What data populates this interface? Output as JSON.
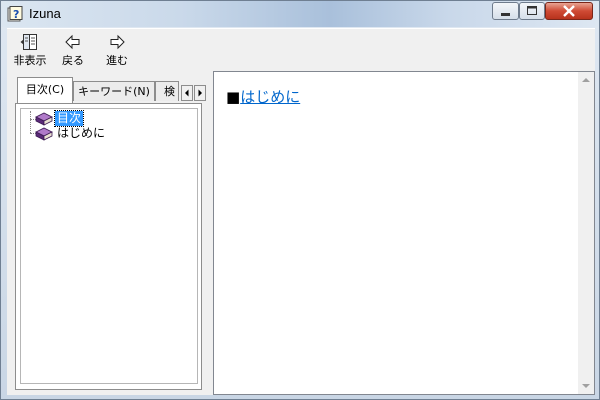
{
  "window": {
    "title": "Izuna",
    "icon": "help-question-icon"
  },
  "caption_buttons": {
    "minimize_icon": "minimize-icon",
    "maximize_icon": "maximize-icon",
    "close_icon": "close-icon"
  },
  "toolbar": {
    "hide_label": "非表示",
    "back_label": "戻る",
    "forward_label": "進む"
  },
  "tabs": {
    "contents_label": "目次(C)",
    "keyword_label": "キーワード(N)",
    "search_label": "検"
  },
  "tree": {
    "items": [
      {
        "label": "目次",
        "icon": "book-icon",
        "selected": true
      },
      {
        "label": "はじめに",
        "icon": "book-icon",
        "selected": false
      }
    ]
  },
  "content": {
    "bullet": "■",
    "heading_link": "はじめに"
  },
  "colors": {
    "selection": "#3399ff",
    "link": "#0066cc",
    "book": "#7b3f9a"
  }
}
